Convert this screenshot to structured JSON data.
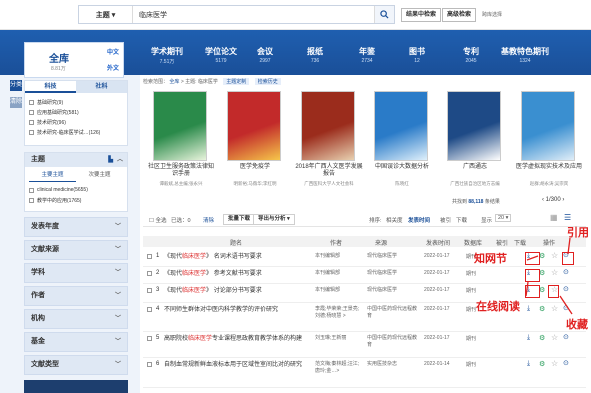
{
  "search": {
    "field_label": "主题",
    "query": "临床医学",
    "secondary_btn": "结果中检索",
    "advanced_btn": "高级检索",
    "cross_db_link": "跨库选择"
  },
  "databases": [
    {
      "name": "学术期刊",
      "count": "7.51万"
    },
    {
      "name": "学位论文",
      "count": "5179"
    },
    {
      "name": "会议",
      "count": "2997"
    },
    {
      "name": "报纸",
      "count": "736"
    },
    {
      "name": "年鉴",
      "count": "2734"
    },
    {
      "name": "图书",
      "count": "12"
    },
    {
      "name": "专利",
      "count": "2045"
    },
    {
      "name": "基教特色期刊",
      "count": "1324"
    }
  ],
  "sidebar": {
    "all_label": "全库",
    "all_count": "8.81万",
    "lang_zh": "中文",
    "lang_en": "外文",
    "vtab_category": "分类",
    "vtab_clear": "清除",
    "tabs": [
      "科技",
      "社科"
    ],
    "subjects": [
      "基础研究(9)",
      "应用基础研究(581)",
      "技术研究(96)",
      "技术研究-临床医学试…(126)"
    ],
    "topic_header": "主题",
    "topic_tabs": [
      "主要主题",
      "次要主题"
    ],
    "topics": [
      "clinical medicine(5655)",
      "教学中的应用(1765)"
    ],
    "facets": [
      "发表年度",
      "文献来源",
      "学科",
      "作者",
      "机构",
      "基金",
      "文献类型"
    ]
  },
  "crumbs": {
    "label": "检索范围：",
    "items": [
      "全库",
      "主题: 临床医学"
    ],
    "tag1": "主题定制",
    "tag2": "检索历史"
  },
  "books": [
    {
      "title": "社区卫生服务政策法律知识手册",
      "author": "谭毅斌,总主编;张永兴"
    },
    {
      "title": "医学免疫学",
      "author": "明新裕;马薇华;李红明"
    },
    {
      "title": "2018年广西人文医学发展报告",
      "author": "广西医科大学人文社会科"
    },
    {
      "title": "中国误诊大数据分析",
      "author": "陈晓红"
    },
    {
      "title": "广西通志",
      "author": "广西壮族自治区地方志编"
    },
    {
      "title": "医学虚拟现实技术及应用",
      "author": "赵群;胡永涛;吴宗宾"
    }
  ],
  "results": {
    "summary_prefix": "共找到",
    "summary_count": "88,118",
    "summary_suffix": "条结果",
    "page": "1/300",
    "toolbar": {
      "select_all": "全选",
      "selected": "已选：0",
      "clear": "清除",
      "batch": "批量下载",
      "export": "导出与分析 ▾",
      "sort_label": "排序:",
      "sort_rel": "相关度",
      "sort_date": "发表时间",
      "sort_cite": "被引",
      "sort_dl": "下载",
      "show_label": "显示",
      "show_count": "20 ▾"
    },
    "headers": [
      "题名",
      "作者",
      "来源",
      "发表时间",
      "数据库",
      "被引",
      "下载",
      "操作"
    ],
    "rows": [
      {
        "num": "1",
        "pre": "《现代",
        "hl": "临床医学",
        "post": "》 名词术语书写要求",
        "author": "本刊编辑部",
        "source": "现代临床医学",
        "date": "2022-01-17",
        "db": "期刊"
      },
      {
        "num": "2",
        "pre": "《现代",
        "hl": "临床医学",
        "post": "》 参考文献书写要求",
        "author": "本刊编辑部",
        "source": "现代临床医学",
        "date": "2022-01-17",
        "db": "期刊"
      },
      {
        "num": "3",
        "pre": "《现代",
        "hl": "临床医学",
        "post": "》 讨论部分书写要求",
        "author": "本刊编辑部",
        "source": "现代临床医学",
        "date": "2022-01-17",
        "db": "期刊"
      },
      {
        "num": "4",
        "pre": "不同师生群体对中医内科学教学的评价研究",
        "hl": "",
        "post": "",
        "author": "李霞;毕荣荣;王景亮;刘德;杨晓慧 >",
        "source": "中国中医药现代远程教育",
        "date": "2022-01-17",
        "db": "期刊"
      },
      {
        "num": "5",
        "pre": "高职院校",
        "hl": "临床医学",
        "post": "专业课程思政教育教学体系的构建",
        "author": "刘玉琳;王新丽",
        "source": "中国中医药现代远程教育",
        "date": "2022-01-17",
        "db": "期刊"
      },
      {
        "num": "6",
        "pre": "自制血常规新鲜血液标本用于区域性室间比对的研究",
        "hl": "",
        "post": "",
        "author": "范文梅;秦林超;汪江;唐玲;金…>",
        "source": "实用医技杂志",
        "date": "2022-01-14",
        "db": "期刊"
      }
    ]
  },
  "annotations": {
    "zhiwangjie": "知网节",
    "cite": "引用",
    "online_read": "在线阅读",
    "collect": "收藏"
  }
}
